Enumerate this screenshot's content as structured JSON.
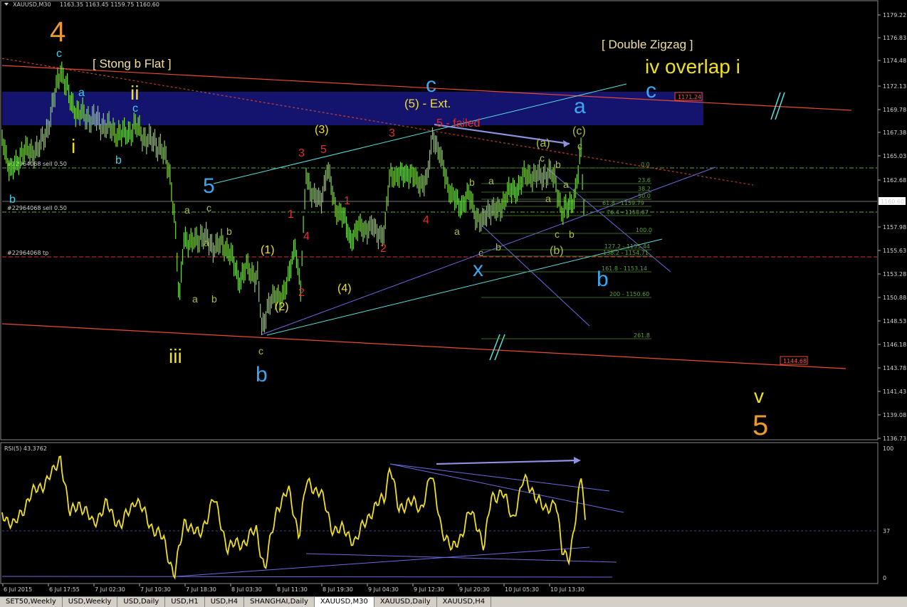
{
  "chart_data": [
    {
      "type": "line",
      "title": "XAUUSD,M30",
      "ohlc_text": "1163.35 1163.45 1159.75 1160.60",
      "ylim": [
        1136.6,
        1181.0
      ],
      "y_ticks": [
        "1179.22",
        "1176.83",
        "1174.48",
        "1172.13",
        "1169.78",
        "1167.38",
        "1165.03",
        "1162.68",
        "1160.60",
        "1157.98",
        "1155.63",
        "1153.28",
        "1150.88",
        "1148.53",
        "1146.18",
        "1143.78",
        "1141.43",
        "1139.08",
        "1136.73"
      ],
      "x_ticks": [
        "6 Jul 2015",
        "6 Jul 17:55",
        "7 Jul 02:30",
        "7 Jul 10:30",
        "7 Jul 18:30",
        "8 Jul 03:30",
        "8 Jul 11:30",
        "8 Jul 19:30",
        "9 Jul 04:30",
        "9 Jul 12:30",
        "9 Jul 20:30",
        "10 Jul 05:30",
        "10 Jul 13:30"
      ],
      "current_price": "1160.60",
      "price_tags": [
        "1171.24",
        "1144.68"
      ],
      "order_labels": [
        "#22964068 sell 0.50",
        "#22964068 sell 0.50",
        "#22964068 tp"
      ],
      "fib_levels": [
        "0.0",
        "23.6",
        "38.2",
        "50.0",
        "61.8 - 1159.79",
        "76.4 - 1158.67",
        "100.0",
        "127.2 - 1155.44",
        "138.2 - 1154.71",
        "161.8 - 1153.14",
        "200 - 1150.60",
        "261.8"
      ],
      "wave_labels": [
        "4",
        "c",
        "[ Stong b Flat ]",
        "a",
        "ii",
        "c",
        "i",
        "b",
        "b",
        "a",
        "c",
        "b",
        "a",
        "b",
        "a",
        "iii",
        "c",
        "b",
        "(1)",
        "(2)",
        "(3)",
        "(4)",
        "1",
        "2",
        "3",
        "4",
        "5",
        "1",
        "2",
        "3",
        "4",
        "5",
        "c",
        "(5) - Ext.",
        "5 - failed",
        "b",
        "a",
        "a",
        "c",
        "x",
        "b",
        "(a)",
        "c",
        "b",
        "a",
        "a",
        "c",
        "b",
        "(b)",
        "(c)",
        "c",
        "a",
        "c",
        "b",
        "[ Double Zigzag ]",
        "iv overlap i",
        "v",
        "5"
      ],
      "colors": {
        "bg": "#000000",
        "price": "#7dd848",
        "zone": "#14146e",
        "orange": "#e89a30",
        "cyan": "#40d0e8",
        "yellow": "#f0e020",
        "red": "#e03030",
        "blue": "#3aa8f0",
        "green": "#a8c040",
        "trend_red": "#e84a30",
        "trend_blue": "#6a6ae0",
        "trend_cyan": "#5ae0e0",
        "rsi": "#f0e020",
        "dashed_green": "#58b030",
        "dashed_red": "#e03030"
      }
    },
    {
      "type": "line",
      "title": "RSI(5) 43.3762",
      "ylim": [
        0,
        100
      ],
      "y_ticks": [
        "100",
        "37",
        "0"
      ],
      "level": 37
    }
  ],
  "tabs": [
    "SET50,Weekly",
    "USD,Weekly",
    "USD,Daily",
    "USD,H1",
    "USD,H4",
    "SHANGHAI,Daily",
    "XAUUSD,M30",
    "XAUUSD,Daily",
    "XAUUSD,H4"
  ],
  "active_tab": "XAUUSD,M30"
}
